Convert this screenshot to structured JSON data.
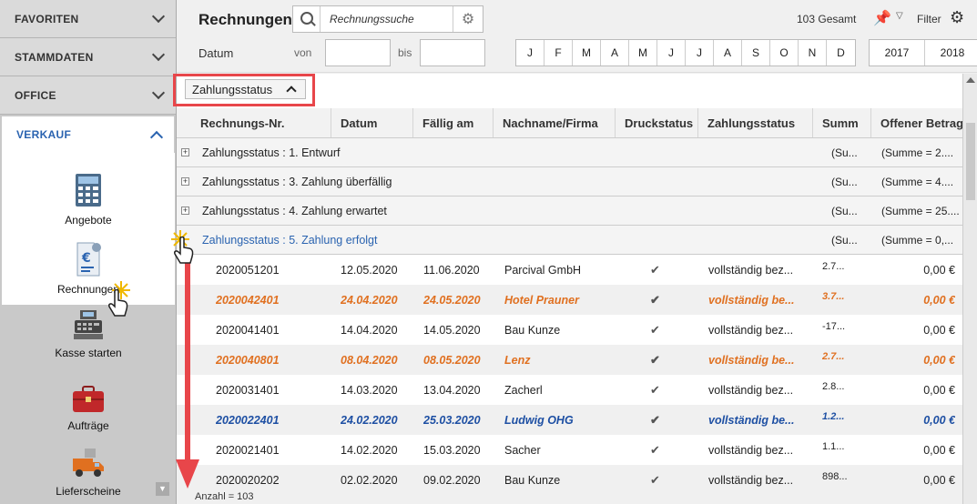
{
  "sidebar": {
    "sections": [
      {
        "label": "FAVORITEN"
      },
      {
        "label": "STAMMDATEN"
      },
      {
        "label": "OFFICE"
      },
      {
        "label": "VERKAUF"
      }
    ],
    "items": [
      {
        "label": "Angebote",
        "icon": "calculator-icon"
      },
      {
        "label": "Rechnungen",
        "icon": "euro-document-icon"
      },
      {
        "label": "Kasse starten",
        "icon": "cash-register-icon"
      },
      {
        "label": "Aufträge",
        "icon": "briefcase-icon"
      },
      {
        "label": "Lieferscheine",
        "icon": "delivery-truck-icon"
      }
    ]
  },
  "header": {
    "title": "Rechnungen",
    "search_placeholder": "Rechnungssuche",
    "total": "103 Gesamt",
    "filter_label": "Filter",
    "date_label": "Datum",
    "von": "von",
    "bis": "bis",
    "months": [
      "J",
      "F",
      "M",
      "A",
      "M",
      "J",
      "J",
      "A",
      "S",
      "O",
      "N",
      "D"
    ],
    "years": [
      "2017",
      "2018"
    ]
  },
  "grouping": {
    "chip_label": "Zahlungsstatus"
  },
  "grid": {
    "columns": [
      "Rechnungs-Nr.",
      "Datum",
      "Fällig am",
      "Nachname/Firma",
      "Druckstatus",
      "Zahlungsstatus",
      "Summ",
      "Offener Betrag"
    ],
    "groups": [
      {
        "label": "Zahlungsstatus : 1. Entwurf",
        "s1": "(Su...",
        "s2": "(Summe = 2...."
      },
      {
        "label": "Zahlungsstatus : 3. Zahlung überfällig",
        "s1": "(Su...",
        "s2": "(Summe = 4...."
      },
      {
        "label": "Zahlungsstatus : 4. Zahlung erwartet",
        "s1": "(Su...",
        "s2": "(Summe = 25...."
      },
      {
        "label": "Zahlungsstatus : 5. Zahlung erfolgt",
        "s1": "(Su...",
        "s2": "(Summe = 0,..."
      }
    ],
    "rows": [
      {
        "nr": "2020051201",
        "datum": "12.05.2020",
        "faellig": "11.06.2020",
        "firma": "Parcival GmbH",
        "druck": "✔",
        "status": "vollständig bez...",
        "summe": "2.7...",
        "offen": "0,00 €"
      },
      {
        "nr": "2020042401",
        "datum": "24.04.2020",
        "faellig": "24.05.2020",
        "firma": "Hotel Prauner",
        "druck": "✔",
        "status": "vollständig be...",
        "summe": "3.7...",
        "offen": "0,00 €"
      },
      {
        "nr": "2020041401",
        "datum": "14.04.2020",
        "faellig": "14.05.2020",
        "firma": "Bau Kunze",
        "druck": "✔",
        "status": "vollständig bez...",
        "summe": "-17...",
        "offen": "0,00 €"
      },
      {
        "nr": "2020040801",
        "datum": "08.04.2020",
        "faellig": "08.05.2020",
        "firma": "Lenz",
        "druck": "✔",
        "status": "vollständig be...",
        "summe": "2.7...",
        "offen": "0,00 €"
      },
      {
        "nr": "2020031401",
        "datum": "14.03.2020",
        "faellig": "13.04.2020",
        "firma": "Zacherl",
        "druck": "✔",
        "status": "vollständig bez...",
        "summe": "2.8...",
        "offen": "0,00 €"
      },
      {
        "nr": "2020022401",
        "datum": "24.02.2020",
        "faellig": "25.03.2020",
        "firma": "Ludwig OHG",
        "druck": "✔",
        "status": "vollständig be...",
        "summe": "1.2...",
        "offen": "0,00 €"
      },
      {
        "nr": "2020021401",
        "datum": "14.02.2020",
        "faellig": "15.03.2020",
        "firma": "Sacher",
        "druck": "✔",
        "status": "vollständig bez...",
        "summe": "1.1...",
        "offen": "0,00 €"
      },
      {
        "nr": "2020020202",
        "datum": "02.02.2020",
        "faellig": "09.02.2020",
        "firma": "Bau Kunze",
        "druck": "✔",
        "status": "vollständig bez...",
        "summe": "898...",
        "offen": "0,00 €"
      }
    ],
    "footer": "Anzahl = 103"
  },
  "colors": {
    "accent_blue": "#2a63b0",
    "highlight_orange": "#e07020",
    "link_blue": "#1d4fa3",
    "annotation_red": "#e8464a"
  }
}
